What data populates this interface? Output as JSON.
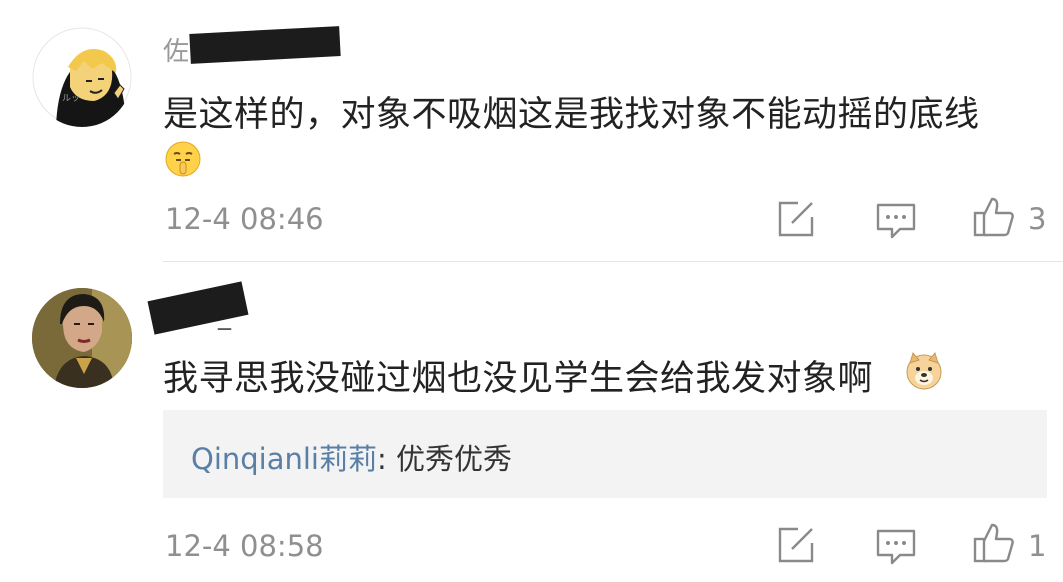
{
  "comments": [
    {
      "username": "佐",
      "text": "是这样的，对象不吸烟这是我找对象不能动摇的底线",
      "emoji": "shushing-face-emoji",
      "time": "12-4 08:46",
      "like_count": "3"
    },
    {
      "username": "_",
      "text": "我寻思我没碰过烟也没见学生会给我发对象啊",
      "emoji": "doge-emoji",
      "time": "12-4 08:58",
      "like_count": "1",
      "reply": {
        "user": "Qinqianli莉莉",
        "text": ": 优秀优秀"
      }
    }
  ],
  "icons": {
    "share": "share-edit-icon",
    "comment": "comment-icon",
    "like": "thumbs-up-icon"
  },
  "colors": {
    "reply_user": "#5a7fa6",
    "meta_gray": "#8f8f8f",
    "reply_bg": "#f3f3f3"
  }
}
